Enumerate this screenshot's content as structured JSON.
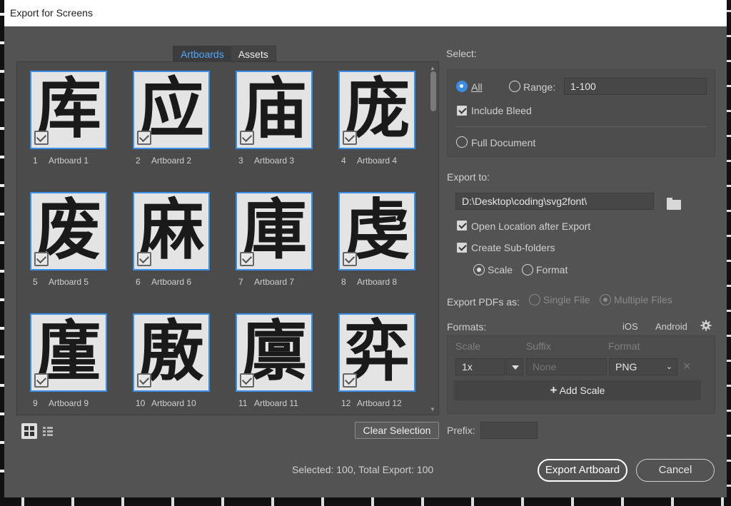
{
  "window": {
    "title": "Export for Screens"
  },
  "tabs": [
    {
      "label": "Artboards",
      "active": true
    },
    {
      "label": "Assets",
      "active": false
    }
  ],
  "artboards": [
    {
      "num": "1",
      "label": "Artboard 1",
      "glyph": "库"
    },
    {
      "num": "2",
      "label": "Artboard 2",
      "glyph": "应"
    },
    {
      "num": "3",
      "label": "Artboard 3",
      "glyph": "庙"
    },
    {
      "num": "4",
      "label": "Artboard 4",
      "glyph": "庞"
    },
    {
      "num": "5",
      "label": "Artboard 5",
      "glyph": "废"
    },
    {
      "num": "6",
      "label": "Artboard 6",
      "glyph": "麻"
    },
    {
      "num": "7",
      "label": "Artboard 7",
      "glyph": "庫"
    },
    {
      "num": "8",
      "label": "Artboard 8",
      "glyph": "虔"
    },
    {
      "num": "9",
      "label": "Artboard 9",
      "glyph": "廑"
    },
    {
      "num": "10",
      "label": "Artboard 10",
      "glyph": "廒"
    },
    {
      "num": "11",
      "label": "Artboard 11",
      "glyph": "廪"
    },
    {
      "num": "12",
      "label": "Artboard 12",
      "glyph": "弈"
    }
  ],
  "footer_left": {
    "clear_selection": "Clear Selection",
    "status": "Selected: 100, Total Export: 100"
  },
  "select": {
    "heading": "Select:",
    "all_label": "All",
    "range_label": "Range:",
    "range_value": "1-100",
    "include_bleed": "Include Bleed",
    "full_document": "Full Document",
    "selected_option": "All"
  },
  "export_to": {
    "heading": "Export to:",
    "path": "D:\\Desktop\\coding\\svg2font\\",
    "open_location": "Open Location after Export",
    "create_subfolders": "Create Sub-folders",
    "scale_label": "Scale",
    "format_label": "Format",
    "subfolder_option": "Scale"
  },
  "export_pdfs": {
    "label": "Export PDFs as:",
    "single_file": "Single File",
    "multiple_files": "Multiple Files"
  },
  "formats": {
    "heading": "Formats:",
    "ios": "iOS",
    "android": "Android",
    "col_scale": "Scale",
    "col_suffix": "Suffix",
    "col_format": "Format",
    "row": {
      "scale": "1x",
      "suffix_placeholder": "None",
      "format": "PNG"
    },
    "add_scale": "Add Scale"
  },
  "prefix": {
    "label": "Prefix:",
    "value": ""
  },
  "buttons": {
    "export": "Export Artboard",
    "cancel": "Cancel"
  },
  "icons": [
    "folder-icon",
    "gear-icon",
    "close-icon",
    "chevron-down-icon",
    "grid-view-icon",
    "list-view-icon",
    "plus-icon",
    "check-icon"
  ]
}
